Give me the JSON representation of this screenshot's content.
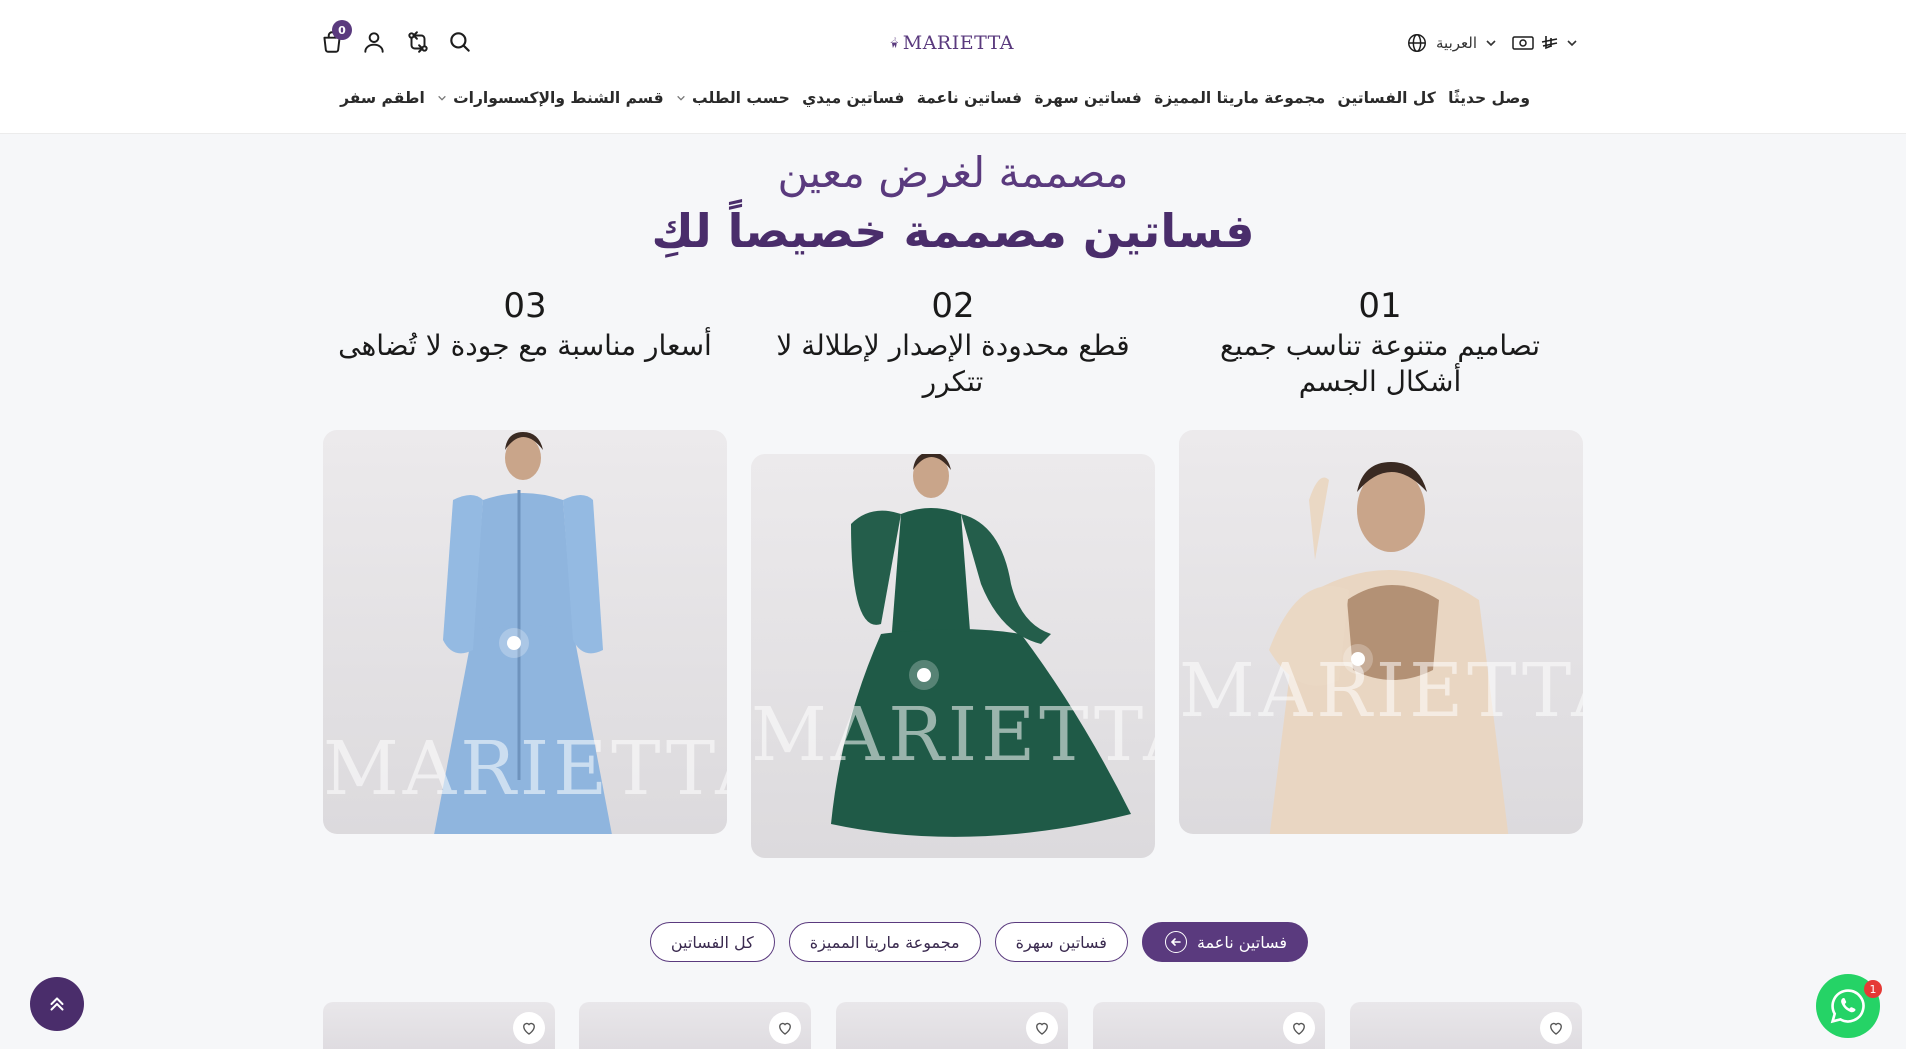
{
  "header": {
    "brand": "MARIETTA",
    "cart_count": "0",
    "language_label": "العربية",
    "nav": [
      {
        "label": "وصل حديثًا",
        "has_dropdown": false
      },
      {
        "label": "كل الفساتين",
        "has_dropdown": false
      },
      {
        "label": "مجموعة ماريتا المميزة",
        "has_dropdown": false
      },
      {
        "label": "فساتين سهرة",
        "has_dropdown": false
      },
      {
        "label": "فساتين ناعمة",
        "has_dropdown": false
      },
      {
        "label": "فساتين ميدي",
        "has_dropdown": false
      },
      {
        "label": "حسب الطلب",
        "has_dropdown": true
      },
      {
        "label": "قسم الشنط والإكسسوارات",
        "has_dropdown": true
      },
      {
        "label": "اطقم سفر",
        "has_dropdown": false
      }
    ]
  },
  "hero": {
    "title": "مصممة لغرض معين",
    "subtitle": "فساتين مصممة خصيصاً لكِ"
  },
  "features": [
    {
      "number": "01",
      "text": "تصاميم متنوعة تناسب جميع أشكال الجسم"
    },
    {
      "number": "02",
      "text": "قطع محدودة الإصدار لإطلالة لا تتكرر"
    },
    {
      "number": "03",
      "text": "أسعار مناسبة مع جودة لا تُضاهى"
    }
  ],
  "photos": [
    {
      "watermark": "MARIETTA",
      "dress_color": "#e9d6c2"
    },
    {
      "watermark": "MARIETTA",
      "dress_color": "#1f5a47"
    },
    {
      "watermark": "MARIETTA",
      "dress_color": "#8fb5de"
    }
  ],
  "filters": [
    {
      "label": "فساتين ناعمة",
      "active": true
    },
    {
      "label": "فساتين سهرة",
      "active": false
    },
    {
      "label": "مجموعة ماريتا المميزة",
      "active": false
    },
    {
      "label": "كل الفساتين",
      "active": false
    }
  ],
  "whatsapp_badge": "1",
  "colors": {
    "brand": "#5a3a7e",
    "brand_dark": "#4a2d6b",
    "whatsapp": "#25d366"
  },
  "icons": [
    "cart-icon",
    "user-icon",
    "compare-icon",
    "search-icon",
    "globe-icon",
    "currency-icon",
    "heart-icon",
    "arrow-left-icon",
    "double-chevron-up-icon",
    "whatsapp-icon"
  ]
}
